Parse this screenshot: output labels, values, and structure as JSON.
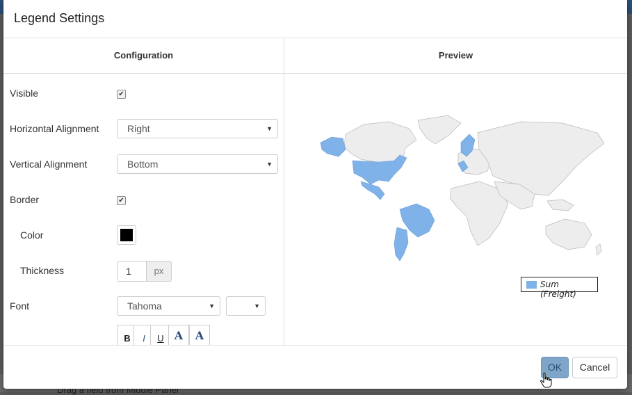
{
  "dialog": {
    "title": "Legend Settings",
    "config_header": "Configuration",
    "preview_header": "Preview"
  },
  "config": {
    "visible": {
      "label": "Visible",
      "checked": true
    },
    "horizontal_alignment": {
      "label": "Horizontal Alignment",
      "value": "Right"
    },
    "vertical_alignment": {
      "label": "Vertical Alignment",
      "value": "Bottom"
    },
    "border": {
      "label": "Border",
      "checked": true
    },
    "color": {
      "label": "Color",
      "value": "#000000"
    },
    "thickness": {
      "label": "Thickness",
      "value": "1",
      "unit": "px"
    },
    "font": {
      "label": "Font",
      "family": "Tahoma",
      "size": ""
    },
    "format_buttons": [
      "B",
      "I",
      "U",
      "A",
      "A"
    ]
  },
  "preview": {
    "legend_label": "Sum (Freight)",
    "highlight_color": "#7fb2e8",
    "land_color": "#ededed"
  },
  "footer": {
    "ok_label": "OK",
    "cancel_label": "Cancel"
  },
  "background": {
    "partial_text": "Drag a field from Middle Panel"
  }
}
